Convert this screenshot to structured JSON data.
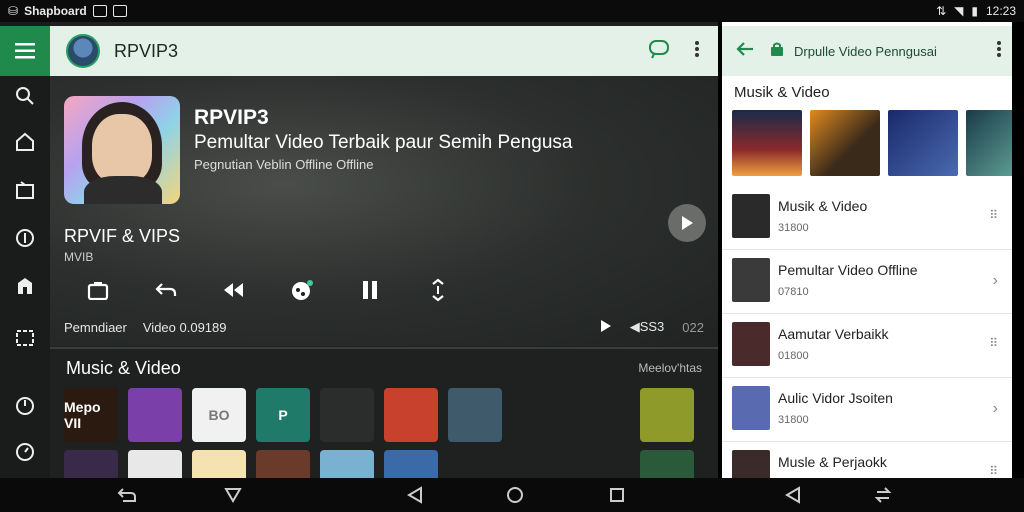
{
  "status": {
    "app_label": "Shapboard",
    "time": "12:23"
  },
  "topbar": {
    "title": "RPVIP3"
  },
  "hero": {
    "title": "RPVIP3",
    "subtitle": "Pemultar Video Terbaik paur Semih Pengusa",
    "caption": "Pegnutian Veblin Offline Offline",
    "track_title": "RPVIF & VIPS",
    "track_sub": "MVIB",
    "progress_label": "Pemndiaer",
    "progress_time": "Video 0.09189",
    "counter_a": "SS3",
    "counter_b": "022"
  },
  "section": {
    "title": "Music & Video",
    "more": "Meelov'htas"
  },
  "tiles_row1": [
    {
      "label": "Mepo VII",
      "color": "#2a1a10"
    },
    {
      "label": "",
      "color": "#7a3fa8"
    },
    {
      "label": "BO",
      "color": "#f1f1f1"
    },
    {
      "label": "P",
      "color": "#1f7a6a"
    },
    {
      "label": "",
      "color": "#2a2d2b"
    },
    {
      "label": "",
      "color": "#c8412c"
    },
    {
      "label": "",
      "color": "#3e5a6b"
    },
    {
      "label": "",
      "color": "#1e2120"
    },
    {
      "label": "",
      "color": "#1e2120"
    },
    {
      "label": "",
      "color": "#8e9a2a"
    }
  ],
  "panel": {
    "header_title": "Drpulle Video Penngusai",
    "section_title": "Musik & Video",
    "list": [
      {
        "title": "Musik & Video",
        "sub": "31800",
        "end": "dots"
      },
      {
        "title": "Pemultar Video Offline",
        "sub": "07810",
        "end": "chevron"
      },
      {
        "title": "Aamutar Verbaikk",
        "sub": "01800",
        "end": "dots"
      },
      {
        "title": "Aulic Vidor Jsoiten",
        "sub": "31800",
        "end": "chevron"
      },
      {
        "title": "Musle & Perjaokk",
        "sub": "",
        "end": "dots"
      }
    ]
  },
  "colors": {
    "accent": "#1f8a4c",
    "topbar_bg": "#e3f1e8"
  }
}
